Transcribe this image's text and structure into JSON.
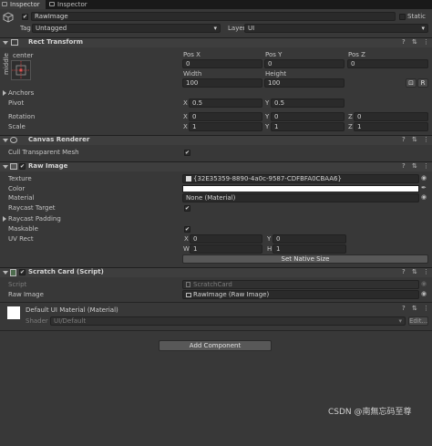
{
  "tabs": [
    "Inspector",
    "Inspector"
  ],
  "object": {
    "name": "RawImage",
    "static_label": "Static",
    "tag_label": "Tag",
    "tag_value": "Untagged",
    "layer_label": "Layer",
    "layer_value": "UI"
  },
  "rect_transform": {
    "title": "Rect Transform",
    "anchor_h": "center",
    "anchor_v": "middle",
    "pos_x_label": "Pos X",
    "pos_y_label": "Pos Y",
    "pos_z_label": "Pos Z",
    "pos_x": "0",
    "pos_y": "0",
    "pos_z": "0",
    "width_label": "Width",
    "height_label": "Height",
    "width": "100",
    "height": "100",
    "anchors_label": "Anchors",
    "pivot_label": "Pivot",
    "pivot_x": "0.5",
    "pivot_y": "0.5",
    "rotation_label": "Rotation",
    "rot_x": "0",
    "rot_y": "0",
    "rot_z": "0",
    "scale_label": "Scale",
    "scale_x": "1",
    "scale_y": "1",
    "scale_z": "1",
    "btn_blueprint": "⊡",
    "btn_raw": "R"
  },
  "canvas_renderer": {
    "title": "Canvas Renderer",
    "cull_label": "Cull Transparent Mesh"
  },
  "raw_image": {
    "title": "Raw Image",
    "texture_label": "Texture",
    "texture_value": "{32E35359-8890-4a0c-9587-CDFBFA0CBAA6}",
    "color_label": "Color",
    "material_label": "Material",
    "material_value": "None (Material)",
    "raycast_target_label": "Raycast Target",
    "raycast_padding_label": "Raycast Padding",
    "maskable_label": "Maskable",
    "uv_rect_label": "UV Rect",
    "uv_x": "0",
    "uv_y": "0",
    "uv_w": "1",
    "uv_h": "1",
    "native_size_button": "Set Native Size"
  },
  "scratch_card": {
    "title": "Scratch Card (Script)",
    "script_label": "Script",
    "script_value": "ScratchCard",
    "raw_image_label": "Raw Image",
    "raw_image_value": "RawImage (Raw Image)"
  },
  "material": {
    "title": "Default UI Material (Material)",
    "shader_label": "Shader",
    "shader_value": "UI/Default",
    "edit_button": "Edit..."
  },
  "add_component_button": "Add Component",
  "axis": {
    "x": "X",
    "y": "Y",
    "z": "Z",
    "w": "W",
    "h": "H"
  },
  "icons": {
    "help": "?",
    "preset": "⇅",
    "menu": "⋮",
    "check": "✔",
    "picker": "◉",
    "eyedropper": "✒"
  },
  "watermark": "CSDN @南無忘码至尊",
  "colors": {
    "background": "#383838",
    "header": "#3e3e3e",
    "field": "#2a2a2a",
    "color_field": "#ffffff",
    "tabbar": "#191919"
  }
}
